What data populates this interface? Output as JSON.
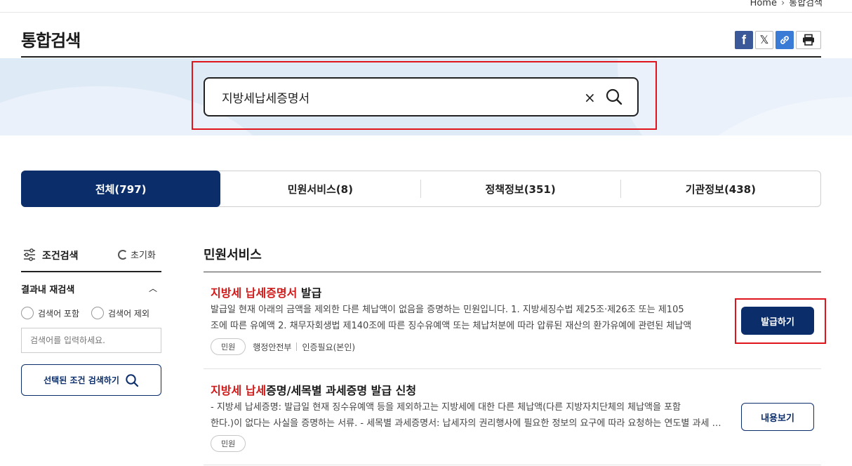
{
  "breadcrumb": {
    "home": "Home",
    "current": "통합검색"
  },
  "page_title": "통합검색",
  "share": {
    "facebook_icon": "facebook-icon",
    "x_icon": "x-icon",
    "link_icon": "link-icon",
    "print_icon": "print-icon"
  },
  "search": {
    "value": "지방세납세증명서",
    "clear_label": "×"
  },
  "tabs": [
    {
      "label": "전체(797)",
      "active": true
    },
    {
      "label": "민원서비스(8)"
    },
    {
      "label": "정책정보(351)"
    },
    {
      "label": "기관정보(438)"
    }
  ],
  "filter": {
    "title": "조건검색",
    "reset_label": "초기화",
    "research_title": "결과내 재검색",
    "option_include": "검색어 포함",
    "option_exclude": "검색어 제외",
    "input_placeholder": "검색어를 입력하세요.",
    "submit_label": "선택된 조건 검색하기"
  },
  "results": {
    "section_title": "민원서비스",
    "items": [
      {
        "title_highlight": "지방세 납세증명서",
        "title_rest": " 발급",
        "desc_line1": "발급일 현재 아래의 금액을 제외한 다른 체납액이 없음을 증명하는 민원입니다. 1. 지방세징수법 제25조·제26조 또는 제105",
        "desc_line2": "조에 따른 유예액 2. 채무자회생법 제140조에 따른 징수유예액 또는 체납처분에 따라 압류된 재산의 환가유예에 관련된 체납액",
        "chip": "민원",
        "agency": "행정안전부",
        "auth": "인증필요(본인)",
        "button": "발급하기"
      },
      {
        "title_highlight": "지방세 납세",
        "title_rest": "증명/세목별 과세증명 발급 신청",
        "desc_line1": "- 지방세 납세증명: 발급일 현재 징수유예액 등을 제외하고는 지방세에 대한 다른 체납액(다른 지방자치단체의 체납액을 포함",
        "desc_line2": "한다.)이 없다는 사실을 증명하는 서류. - 세목별 과세증명서: 납세자의 권리행사에 필요한 정보의 요구에 따라 요청하는 연도별 과세 내역",
        "chip": "민원",
        "button": "내용보기"
      }
    ]
  },
  "colors": {
    "navy": "#0b2e6b",
    "highlight": "#d11a1a",
    "banner": "#dfeaf7",
    "annotation": "#e0151b"
  }
}
